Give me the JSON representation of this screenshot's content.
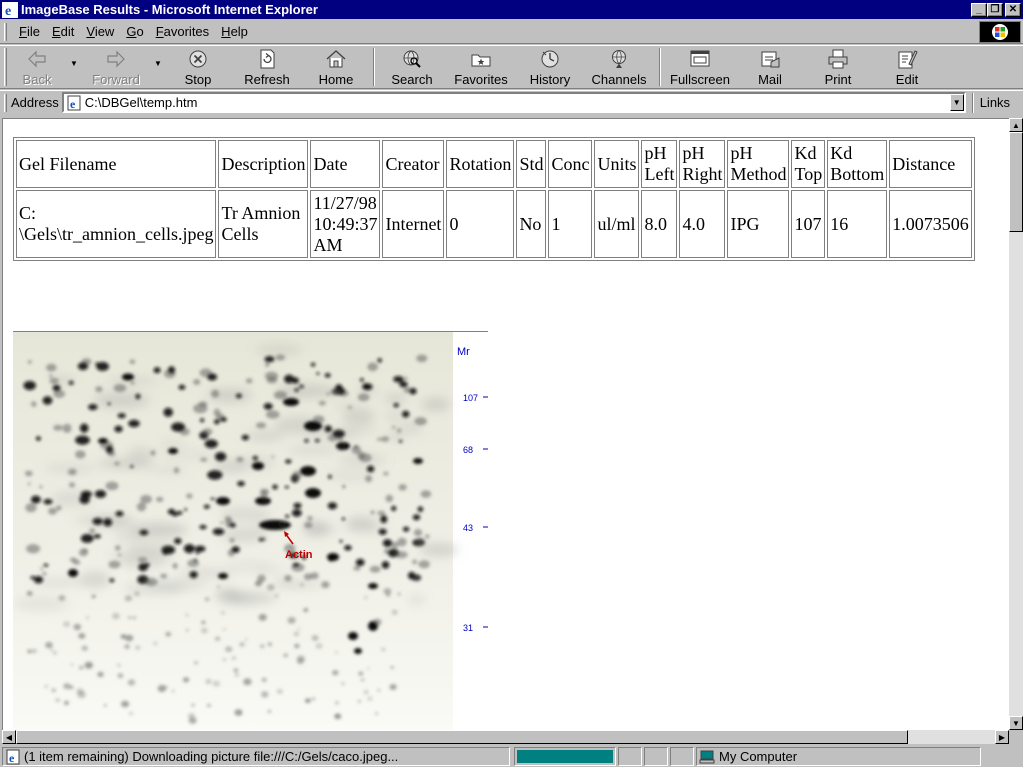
{
  "window": {
    "title": "ImageBase Results - Microsoft Internet Explorer",
    "controls": {
      "minimize": "_",
      "maximize": "❐",
      "close": "✕"
    }
  },
  "menu": {
    "items": [
      {
        "label": "File"
      },
      {
        "label": "Edit"
      },
      {
        "label": "View"
      },
      {
        "label": "Go"
      },
      {
        "label": "Favorites"
      },
      {
        "label": "Help"
      }
    ]
  },
  "toolbar": {
    "back": {
      "label": "Back",
      "icon": "back-arrow-icon",
      "enabled": false
    },
    "forward": {
      "label": "Forward",
      "icon": "forward-arrow-icon",
      "enabled": false
    },
    "stop": {
      "label": "Stop",
      "icon": "stop-icon"
    },
    "refresh": {
      "label": "Refresh",
      "icon": "refresh-icon"
    },
    "home": {
      "label": "Home",
      "icon": "home-icon"
    },
    "search": {
      "label": "Search",
      "icon": "search-globe-icon"
    },
    "favorites": {
      "label": "Favorites",
      "icon": "favorites-folder-icon"
    },
    "history": {
      "label": "History",
      "icon": "history-icon"
    },
    "channels": {
      "label": "Channels",
      "icon": "channels-icon"
    },
    "fullscreen": {
      "label": "Fullscreen",
      "icon": "fullscreen-icon"
    },
    "mail": {
      "label": "Mail",
      "icon": "mail-icon"
    },
    "print": {
      "label": "Print",
      "icon": "printer-icon"
    },
    "edit": {
      "label": "Edit",
      "icon": "edit-icon"
    }
  },
  "address": {
    "label": "Address",
    "value": "C:\\DBGel\\temp.htm",
    "links_label": "Links"
  },
  "table": {
    "headers": [
      [
        "Gel Filename"
      ],
      [
        "Description"
      ],
      [
        "Date"
      ],
      [
        "Creator"
      ],
      [
        "Rotation"
      ],
      [
        "Std"
      ],
      [
        "Conc"
      ],
      [
        "Units"
      ],
      [
        "pH",
        "Left"
      ],
      [
        "pH",
        "Right"
      ],
      [
        "pH",
        "Method"
      ],
      [
        "Kd",
        "Top"
      ],
      [
        "Kd",
        "Bottom"
      ],
      [
        "Distance"
      ]
    ],
    "row": [
      [
        "C:",
        "\\Gels\\tr_amnion_cells.jpeg"
      ],
      [
        "Tr Amnion",
        "Cells"
      ],
      [
        "11/27/98",
        "10:49:37",
        "AM"
      ],
      [
        "Internet"
      ],
      [
        "0"
      ],
      [
        "No"
      ],
      [
        "1"
      ],
      [
        "ul/ml"
      ],
      [
        "8.0"
      ],
      [
        "4.0"
      ],
      [
        "IPG"
      ],
      [
        "107"
      ],
      [
        "16"
      ],
      [
        "1.0073506"
      ]
    ]
  },
  "gel_image": {
    "mr_label": "Mr",
    "markers": [
      "107",
      "68",
      "43",
      "31"
    ],
    "annotation": "Actin",
    "marker_color": "#0000c0",
    "annotation_color": "#c00000"
  },
  "status": {
    "message": "(1 item remaining) Downloading picture file:///C:/Gels/caco.jpeg...",
    "progress": 1.0,
    "zone": "My Computer"
  }
}
